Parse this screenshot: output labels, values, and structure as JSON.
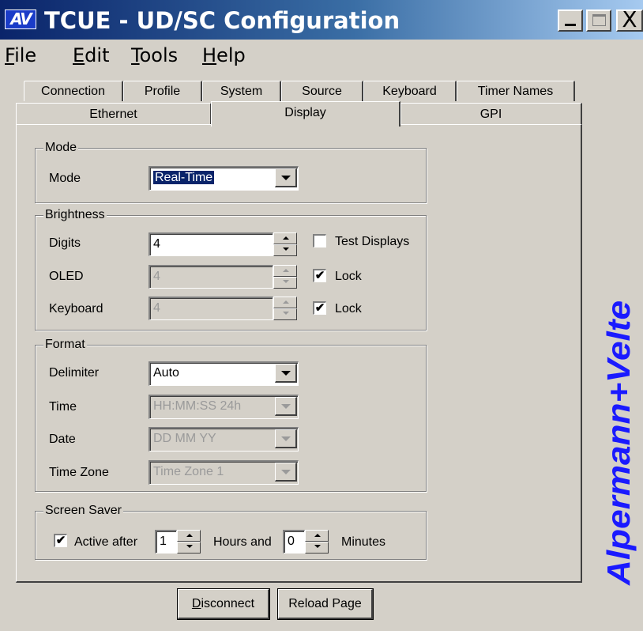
{
  "window": {
    "logo_text": "AV",
    "title": "TCUE - UD/SC Configuration",
    "close_glyph": "X"
  },
  "menu": [
    {
      "accel": "F",
      "rest": "ile"
    },
    {
      "accel": "E",
      "rest": "dit"
    },
    {
      "accel": "T",
      "rest": "ools"
    },
    {
      "accel": "H",
      "rest": "elp"
    }
  ],
  "tabs_row1": [
    "Connection",
    "Profile",
    "System",
    "Source",
    "Keyboard",
    "Timer Names"
  ],
  "tabs_row2": [
    "Ethernet",
    "Display",
    "GPI"
  ],
  "active_tab": "Display",
  "mode_group": {
    "legend": "Mode",
    "mode_label": "Mode",
    "mode_value": "Real-Time"
  },
  "brightness_group": {
    "legend": "Brightness",
    "digits_label": "Digits",
    "digits_value": "4",
    "test_displays_label": "Test Displays",
    "test_displays_checked": false,
    "oled_label": "OLED",
    "oled_value": "4",
    "oled_lock_label": "Lock",
    "oled_lock_checked": true,
    "keyboard_label": "Keyboard",
    "keyboard_value": "4",
    "keyboard_lock_label": "Lock",
    "keyboard_lock_checked": true
  },
  "format_group": {
    "legend": "Format",
    "delimiter_label": "Delimiter",
    "delimiter_value": "Auto",
    "time_label": "Time",
    "time_value": "HH:MM:SS 24h",
    "date_label": "Date",
    "date_value": "DD MM YY",
    "timezone_label": "Time Zone",
    "timezone_value": "Time Zone 1"
  },
  "screensaver_group": {
    "legend": "Screen Saver",
    "active_after_label": "Active after",
    "active_checked": true,
    "hours_value": "1",
    "hours_label": "Hours and",
    "minutes_value": "0",
    "minutes_label": "Minutes"
  },
  "brand_text": "Alpermann+Velte",
  "brand_color": "#1a1aff",
  "buttons": {
    "disconnect": {
      "accel": "D",
      "rest": "isconnect"
    },
    "reload": "Reload Page"
  },
  "check_glyph": "✔"
}
